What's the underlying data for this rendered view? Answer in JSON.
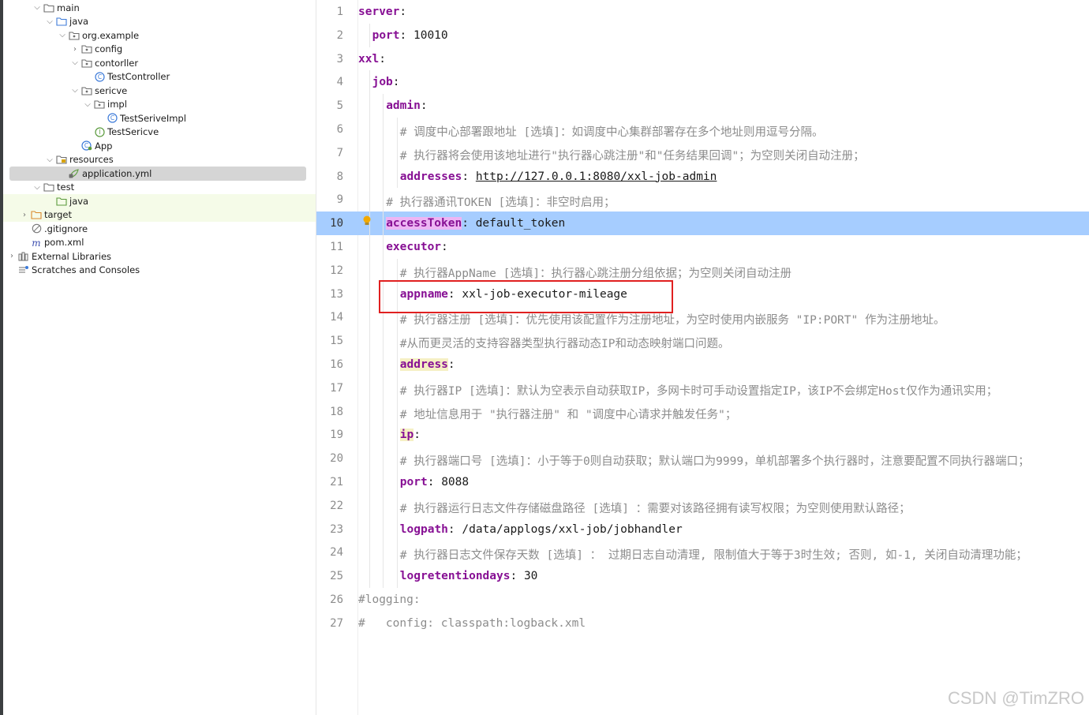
{
  "project_tree": {
    "items": [
      {
        "label": "main",
        "depth": 2,
        "chevron": "expanded",
        "icon": "folder-icon"
      },
      {
        "label": "java",
        "depth": 3,
        "chevron": "expanded",
        "icon": "source-folder-icon"
      },
      {
        "label": "org.example",
        "depth": 4,
        "chevron": "expanded",
        "icon": "package-icon"
      },
      {
        "label": "config",
        "depth": 5,
        "chevron": "collapsed",
        "icon": "package-icon"
      },
      {
        "label": "contorller",
        "depth": 5,
        "chevron": "expanded",
        "icon": "package-icon"
      },
      {
        "label": "TestController",
        "depth": 6,
        "chevron": "none",
        "icon": "class-icon"
      },
      {
        "label": "sericve",
        "depth": 5,
        "chevron": "expanded",
        "icon": "package-icon"
      },
      {
        "label": "impl",
        "depth": 6,
        "chevron": "expanded",
        "icon": "package-icon"
      },
      {
        "label": "TestSeriveImpl",
        "depth": 7,
        "chevron": "none",
        "icon": "class-icon"
      },
      {
        "label": "TestSericve",
        "depth": 6,
        "chevron": "none",
        "icon": "interface-icon"
      },
      {
        "label": "App",
        "depth": 5,
        "chevron": "none",
        "icon": "app-class-icon"
      },
      {
        "label": "resources",
        "depth": 3,
        "chevron": "expanded",
        "icon": "resources-folder-icon"
      },
      {
        "label": "application.yml",
        "depth": 4,
        "chevron": "none",
        "icon": "yaml-file-icon",
        "selected": true
      },
      {
        "label": "test",
        "depth": 2,
        "chevron": "expanded",
        "icon": "folder-icon"
      },
      {
        "label": "java",
        "depth": 3,
        "chevron": "none",
        "icon": "test-source-folder-icon",
        "highlighted": true
      },
      {
        "label": "target",
        "depth": 1,
        "chevron": "collapsed",
        "icon": "excluded-folder-icon",
        "highlighted": true
      },
      {
        "label": ".gitignore",
        "depth": 1,
        "chevron": "none",
        "icon": "ignored-file-icon"
      },
      {
        "label": "pom.xml",
        "depth": 1,
        "chevron": "none",
        "icon": "maven-file-icon"
      },
      {
        "label": "External Libraries",
        "depth": 0,
        "chevron": "collapsed",
        "icon": "library-icon"
      },
      {
        "label": "Scratches and Consoles",
        "depth": 0,
        "chevron": "none",
        "icon": "scratches-icon"
      }
    ]
  },
  "editor": {
    "current_line": 10,
    "lines": [
      {
        "n": "1",
        "indent": 0,
        "parts": [
          {
            "t": "server",
            "c": "k"
          },
          {
            "t": ":",
            "c": "pc"
          }
        ]
      },
      {
        "n": "2",
        "indent": 1,
        "parts": [
          {
            "t": "port",
            "c": "k"
          },
          {
            "t": ": ",
            "c": "pc"
          },
          {
            "t": "10010",
            "c": "v"
          }
        ]
      },
      {
        "n": "3",
        "indent": 0,
        "parts": [
          {
            "t": "xxl",
            "c": "k"
          },
          {
            "t": ":",
            "c": "pc"
          }
        ]
      },
      {
        "n": "4",
        "indent": 1,
        "parts": [
          {
            "t": "job",
            "c": "k"
          },
          {
            "t": ":",
            "c": "pc"
          }
        ]
      },
      {
        "n": "5",
        "indent": 2,
        "parts": [
          {
            "t": "admin",
            "c": "k"
          },
          {
            "t": ":",
            "c": "pc"
          }
        ]
      },
      {
        "n": "6",
        "indent": 3,
        "parts": [
          {
            "t": "# 调度中心部署跟地址 [选填]：如调度中心集群部署存在多个地址则用逗号分隔。",
            "c": "cm"
          }
        ]
      },
      {
        "n": "7",
        "indent": 3,
        "parts": [
          {
            "t": "# 执行器将会使用该地址进行\"执行器心跳注册\"和\"任务结果回调\"；为空则关闭自动注册；",
            "c": "cm"
          }
        ]
      },
      {
        "n": "8",
        "indent": 3,
        "parts": [
          {
            "t": "addresses",
            "c": "k"
          },
          {
            "t": ": ",
            "c": "pc"
          },
          {
            "t": "http://127.0.0.1:8080/xxl-job-admin",
            "c": "u"
          }
        ]
      },
      {
        "n": "9",
        "indent": 2,
        "parts": [
          {
            "t": "# 执行器通讯TOKEN [选填]：非空时启用；",
            "c": "cm"
          }
        ]
      },
      {
        "n": "10",
        "indent": 2,
        "parts": [
          {
            "t": "accessToken",
            "c": "k hlkey"
          },
          {
            "t": ": ",
            "c": "pc"
          },
          {
            "t": "default_token",
            "c": "v"
          }
        ]
      },
      {
        "n": "11",
        "indent": 2,
        "parts": [
          {
            "t": "executor",
            "c": "k"
          },
          {
            "t": ":",
            "c": "pc"
          }
        ]
      },
      {
        "n": "12",
        "indent": 3,
        "parts": [
          {
            "t": "# 执行器AppName [选填]：执行器心跳注册分组依据；为空则关闭自动注册",
            "c": "cm"
          }
        ]
      },
      {
        "n": "13",
        "indent": 3,
        "parts": [
          {
            "t": "appname",
            "c": "k"
          },
          {
            "t": ": ",
            "c": "pc"
          },
          {
            "t": "xxl-job-executor-mileage",
            "c": "v"
          }
        ]
      },
      {
        "n": "14",
        "indent": 3,
        "parts": [
          {
            "t": "# 执行器注册 [选填]：优先使用该配置作为注册地址，为空时使用内嵌服务 \"IP:PORT\" 作为注册地址。",
            "c": "cm"
          }
        ]
      },
      {
        "n": "15",
        "indent": 3,
        "parts": [
          {
            "t": "#从而更灵活的支持容器类型执行器动态IP和动态映射端口问题。",
            "c": "cm"
          }
        ]
      },
      {
        "n": "16",
        "indent": 3,
        "parts": [
          {
            "t": "address",
            "c": "k yel"
          },
          {
            "t": ":",
            "c": "pc"
          }
        ]
      },
      {
        "n": "17",
        "indent": 3,
        "parts": [
          {
            "t": "# 执行器IP [选填]：默认为空表示自动获取IP，多网卡时可手动设置指定IP，该IP不会绑定Host仅作为通讯实用；",
            "c": "cm"
          }
        ]
      },
      {
        "n": "18",
        "indent": 3,
        "parts": [
          {
            "t": "# 地址信息用于 \"执行器注册\" 和 \"调度中心请求并触发任务\"；",
            "c": "cm"
          }
        ]
      },
      {
        "n": "19",
        "indent": 3,
        "parts": [
          {
            "t": "ip",
            "c": "k yel"
          },
          {
            "t": ":",
            "c": "pc"
          }
        ]
      },
      {
        "n": "20",
        "indent": 3,
        "parts": [
          {
            "t": "# 执行器端口号 [选填]：小于等于0则自动获取；默认端口为9999，单机部署多个执行器时，注意要配置不同执行器端口；",
            "c": "cm"
          }
        ]
      },
      {
        "n": "21",
        "indent": 3,
        "parts": [
          {
            "t": "port",
            "c": "k"
          },
          {
            "t": ": ",
            "c": "pc"
          },
          {
            "t": "8088",
            "c": "v"
          }
        ]
      },
      {
        "n": "22",
        "indent": 3,
        "parts": [
          {
            "t": "# 执行器运行日志文件存储磁盘路径 [选填] ：需要对该路径拥有读写权限；为空则使用默认路径；",
            "c": "cm"
          }
        ]
      },
      {
        "n": "23",
        "indent": 3,
        "parts": [
          {
            "t": "logpath",
            "c": "k"
          },
          {
            "t": ": ",
            "c": "pc"
          },
          {
            "t": "/data/applogs/xxl-job/jobhandler",
            "c": "v"
          }
        ]
      },
      {
        "n": "24",
        "indent": 3,
        "parts": [
          {
            "t": "# 执行器日志文件保存天数 [选填] ： 过期日志自动清理, 限制值大于等于3时生效; 否则, 如-1, 关闭自动清理功能；",
            "c": "cm"
          }
        ]
      },
      {
        "n": "25",
        "indent": 3,
        "parts": [
          {
            "t": "logretentiondays",
            "c": "k"
          },
          {
            "t": ": ",
            "c": "pc"
          },
          {
            "t": "30",
            "c": "v"
          }
        ]
      },
      {
        "n": "26",
        "indent": 0,
        "parts": [
          {
            "t": "#logging:",
            "c": "cm"
          }
        ]
      },
      {
        "n": "27",
        "indent": 0,
        "parts": [
          {
            "t": "#   config: classpath:logback.xml",
            "c": "cm"
          }
        ]
      }
    ]
  },
  "watermark": "CSDN @TimZRO",
  "colors": {
    "keyword": "#871094",
    "comment": "#8c8c8c",
    "current_line": "#a6cdff",
    "annotation_box": "#e02020"
  }
}
